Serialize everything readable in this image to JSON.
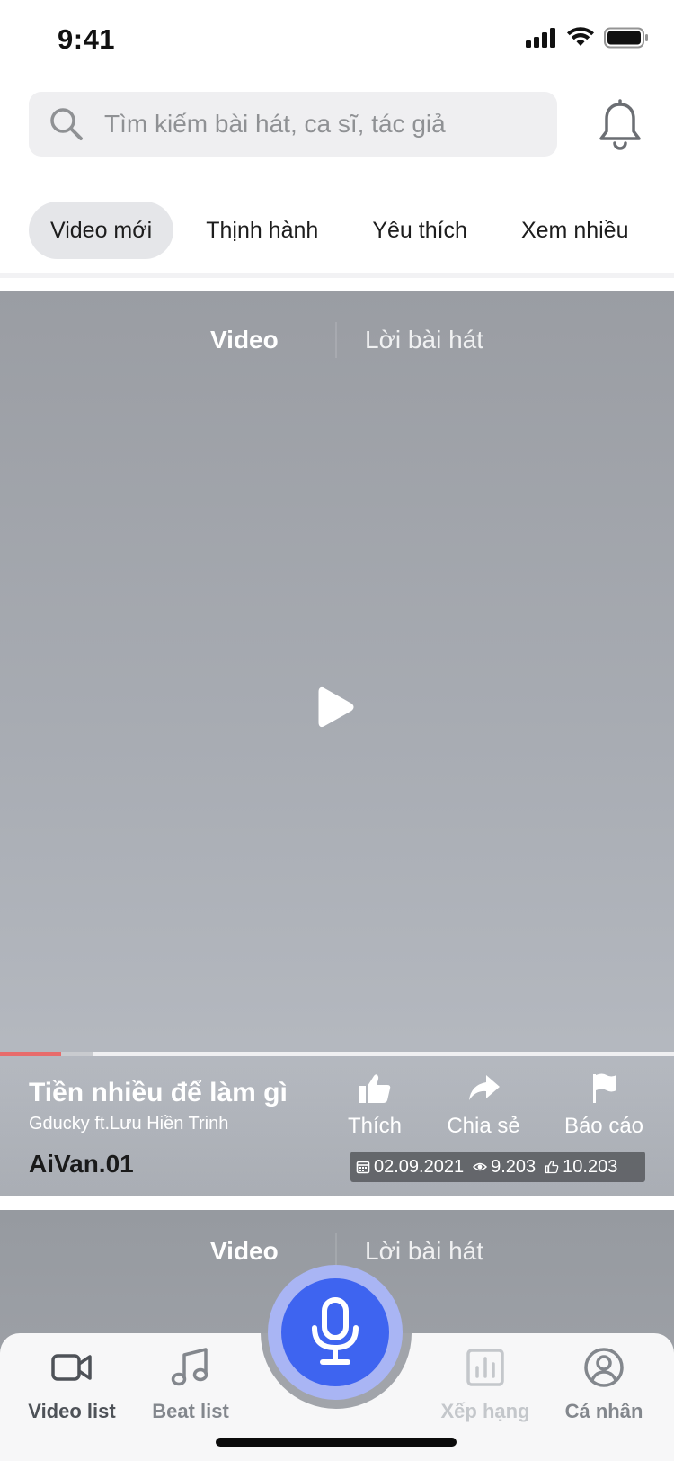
{
  "status_bar": {
    "time": "9:41",
    "icons": [
      "signal-icon",
      "wifi-icon",
      "battery-icon"
    ]
  },
  "search": {
    "placeholder": "Tìm kiếm bài hát, ca sĩ, tác giả",
    "value": "",
    "icon": "search-icon",
    "notification_icon": "bell-icon"
  },
  "category_tabs": [
    {
      "label": "Video mới",
      "active": true
    },
    {
      "label": "Thịnh hành",
      "active": false
    },
    {
      "label": "Yêu thích",
      "active": false
    },
    {
      "label": "Xem nhiều",
      "active": false
    }
  ],
  "video_card": {
    "media_tabs": {
      "video": "Video",
      "lyrics": "Lời bài hát",
      "active": "Video"
    },
    "progress": 0.09,
    "song_title": "Tiền nhiều để làm gì",
    "artist": "Gducky ft.Lưu Hiền Trinh",
    "uploader": "AiVan.01",
    "actions": {
      "like": "Thích",
      "share": "Chia sẻ",
      "report": "Báo cáo"
    },
    "stats": {
      "date": "02.09.2021",
      "views": "9.203",
      "likes": "10.203"
    }
  },
  "next_card": {
    "media_tabs": {
      "video": "Video",
      "lyrics": "Lời bài hát"
    }
  },
  "bottom_nav": {
    "items": [
      {
        "label": "Video list",
        "icon": "video-camera-icon",
        "state": "active"
      },
      {
        "label": "Beat list",
        "icon": "music-note-icon",
        "state": "normal"
      },
      {
        "label": "Xếp hạng",
        "icon": "bar-chart-icon",
        "state": "disabled"
      },
      {
        "label": "Cá nhân",
        "icon": "user-circle-icon",
        "state": "normal"
      }
    ],
    "center_icon": "microphone-icon"
  },
  "colors": {
    "accent": "#3e64f0",
    "accent_ring": "#a9b5f4",
    "progress": "#e76b6b",
    "tab_active_bg": "#e5e6e9"
  }
}
